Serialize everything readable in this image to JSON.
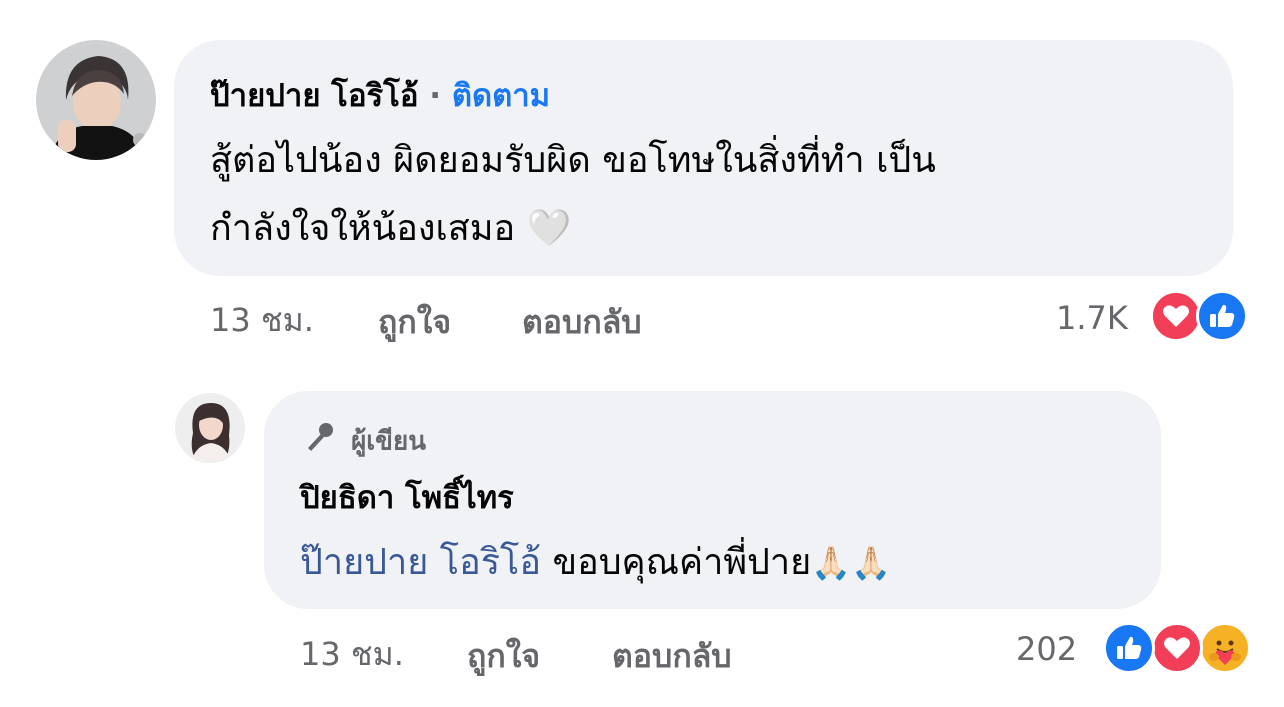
{
  "comment": {
    "author": "ป๊ายปาย โอริโอ้",
    "separator": "·",
    "follow_label": "ติดตาม",
    "text_line1": "สู้ต่อไปน้อง ผิดยอมรับผิด ขอโทษในสิ่งที่ทำ เป็น",
    "text_line2": "กำลังใจให้น้องเสมอ",
    "emoji": "🤍",
    "time": "13 ชม.",
    "like_label": "ถูกใจ",
    "reply_label": "ตอบกลับ",
    "reaction_count": "1.7K",
    "reactions": [
      "love-icon",
      "like-icon"
    ]
  },
  "reply": {
    "badge_label": "ผู้เขียน",
    "author": "ปิยธิดา โพธิ์ไทร",
    "mention": "ป๊ายปาย โอริโอ้",
    "text": "ขอบคุณค่าพี่ปาย",
    "emoji": "🙏🏻🙏🏻",
    "time": "13 ชม.",
    "like_label": "ถูกใจ",
    "reply_label": "ตอบกลับ",
    "reaction_count": "202",
    "reactions": [
      "like-icon",
      "love-icon",
      "care-icon"
    ]
  },
  "colors": {
    "bubble": "#f0f2f5",
    "meta": "#65676b",
    "follow": "#1877f2",
    "mention": "#385898",
    "like": "#1877f2",
    "love": "#f33e58",
    "care": "#f7b125"
  }
}
